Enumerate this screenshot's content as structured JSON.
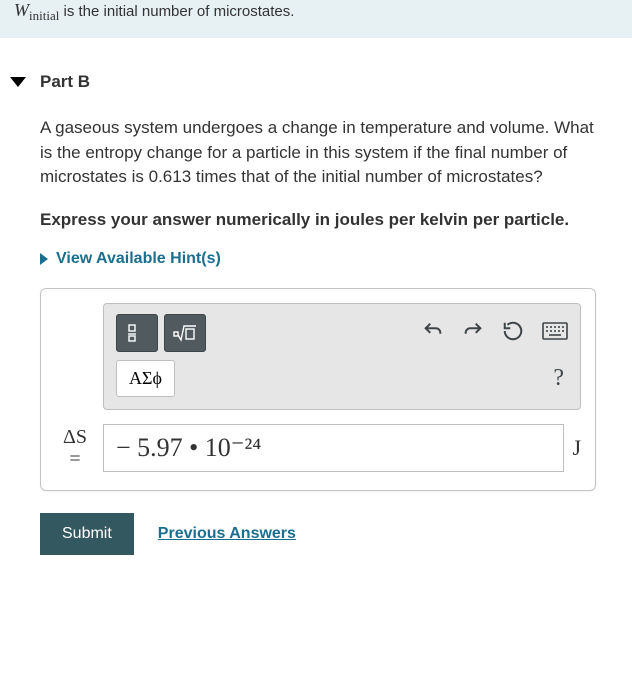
{
  "banner": {
    "w_symbol": "W",
    "w_subscript": "initial",
    "rest": " is the initial number of microstates."
  },
  "part": {
    "label": "Part B"
  },
  "question": "A gaseous system undergoes a change in temperature and volume. What is the entropy change for a particle in this system if the final number of microstates is 0.613 times that of the initial number of microstates?",
  "instruction": "Express your answer numerically in joules per kelvin per particle.",
  "hints_label": "View Available Hint(s)",
  "toolbar": {
    "symbols_label": "ΑΣϕ",
    "help_label": "?"
  },
  "answer": {
    "lhs_top": "ΔS",
    "lhs_bottom": "=",
    "value": "− 5.97 • 10⁻²⁴",
    "unit": "J"
  },
  "footer": {
    "submit": "Submit",
    "previous": "Previous Answers"
  }
}
